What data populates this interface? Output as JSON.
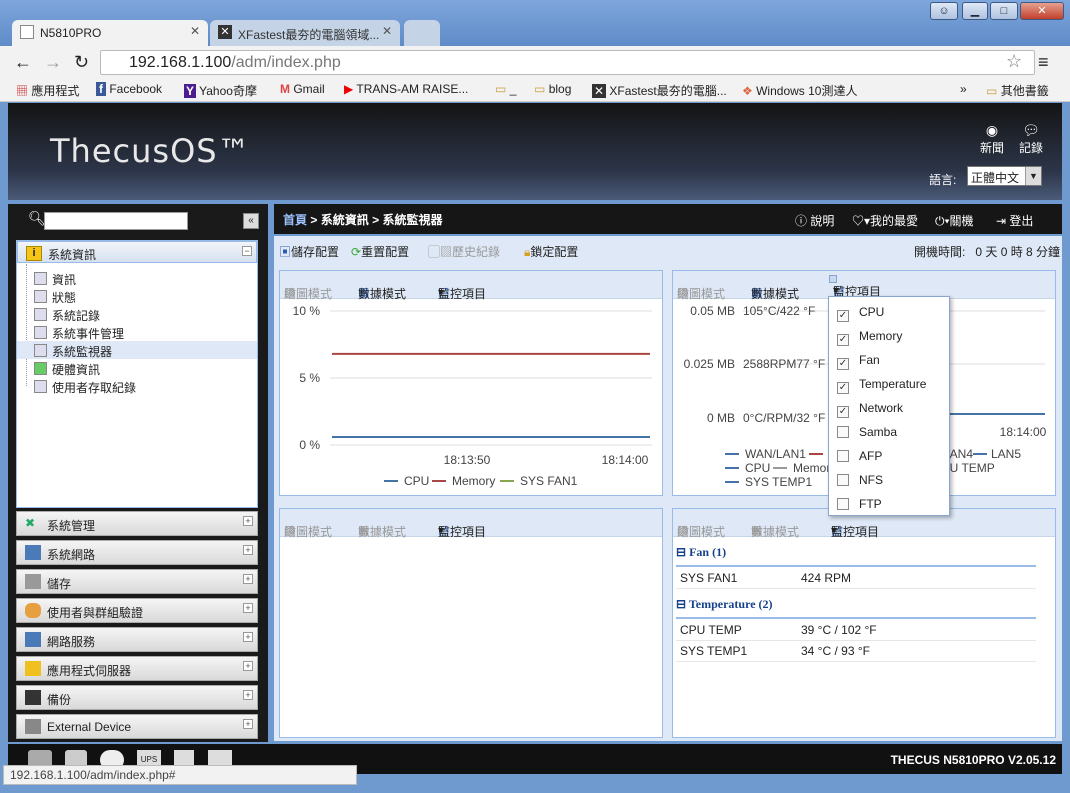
{
  "browser": {
    "tabs": [
      {
        "label": "N5810PRO"
      },
      {
        "label": "XFastest最夯的電腦領域..."
      }
    ],
    "url_host": "192.168.1.100",
    "url_path": "/adm/index.php",
    "status_url": "192.168.1.100/adm/index.php#",
    "bookmarks": [
      "應用程式",
      "Facebook",
      "Yahoo奇摩",
      "Gmail",
      "TRANS-AM RAISE...",
      "_",
      "blog",
      "XFastest最夯的電腦...",
      "Windows 10測達人",
      "»",
      "其他書籤"
    ]
  },
  "header": {
    "logo": "ThecusOS™",
    "news": "新聞",
    "log": "記錄",
    "language_label": "語言:",
    "language_value": "正體中文"
  },
  "breadcrumb": {
    "home": "首頁",
    "sep1": ">",
    "level1": "系統資訊",
    "sep2": ">",
    "level2": "系統監視器"
  },
  "toplinks": {
    "help": "說明",
    "favorites": "我的最愛",
    "shutdown": "關機",
    "logout": "登出"
  },
  "sidebar": {
    "sysinfo_title": "系統資訊",
    "items": [
      {
        "label": "資訊"
      },
      {
        "label": "狀態"
      },
      {
        "label": "系統記錄"
      },
      {
        "label": "系統事件管理"
      },
      {
        "label": "系統監視器"
      },
      {
        "label": "硬體資訊"
      },
      {
        "label": "使用者存取紀錄"
      }
    ],
    "sections": [
      "系統管理",
      "系統網路",
      "儲存",
      "使用者與群組驗證",
      "網路服務",
      "應用程式伺服器",
      "備份",
      "External Device"
    ]
  },
  "toolbar": {
    "save": "儲存配置",
    "reset": "重置配置",
    "history": "歷史紀錄",
    "lock": "鎖定配置",
    "uptime_label": "開機時間:",
    "uptime_value": "0 天 0 時 8 分鐘"
  },
  "panel_tools": {
    "graph": "繪圖模式",
    "data": "數據模式",
    "monitor": "監控項目"
  },
  "chart1": {
    "yticks": [
      "10 %",
      "5 %",
      "0 %"
    ],
    "xticks": [
      "18:13:50",
      "18:14:00"
    ],
    "legend": [
      "CPU",
      "Memory",
      "SYS FAN1"
    ]
  },
  "chart_data": [
    {
      "type": "line",
      "xlabel": "",
      "ylabel": "",
      "ylim": [
        0,
        10
      ],
      "x": [
        "18:13:50",
        "18:14:00"
      ],
      "series": [
        {
          "name": "CPU",
          "values": [
            0.6,
            0.6
          ],
          "color": "#4572a7"
        },
        {
          "name": "Memory",
          "values": [
            6.8,
            6.8
          ],
          "color": "#aa4643"
        },
        {
          "name": "SYS FAN1",
          "values": [
            null,
            null
          ],
          "color": "#89a54e"
        }
      ]
    },
    {
      "type": "line",
      "yticks": [
        "0.05 MB",
        "0.025 MB",
        "0 MB"
      ],
      "overlap_ticks": [
        "105°C/422 °F",
        "2588RPM77 °F",
        "0°C/RPM/32 °F"
      ],
      "xticks": [
        "18:14:00"
      ],
      "legend": [
        "WAN/LAN1",
        "LAN4",
        "LAN5",
        "CPU",
        "Memory",
        "CPU TEMP",
        "SYS TEMP1"
      ]
    }
  ],
  "dropdown": [
    {
      "label": "CPU",
      "checked": true
    },
    {
      "label": "Memory",
      "checked": true
    },
    {
      "label": "Fan",
      "checked": true
    },
    {
      "label": "Temperature",
      "checked": true
    },
    {
      "label": "Network",
      "checked": true
    },
    {
      "label": "Samba",
      "checked": false
    },
    {
      "label": "AFP",
      "checked": false
    },
    {
      "label": "NFS",
      "checked": false
    },
    {
      "label": "FTP",
      "checked": false
    }
  ],
  "datapanel": {
    "fan_title": "Fan (1)",
    "fans": [
      {
        "name": "SYS FAN1",
        "value": "424 RPM"
      }
    ],
    "temp_title": "Temperature (2)",
    "temps": [
      {
        "name": "CPU TEMP",
        "value": "39 °C / 102 °F"
      },
      {
        "name": "SYS TEMP1",
        "value": "34 °C / 93 °F"
      }
    ]
  },
  "footer": {
    "version": "THECUS N5810PRO V2.05.12"
  }
}
